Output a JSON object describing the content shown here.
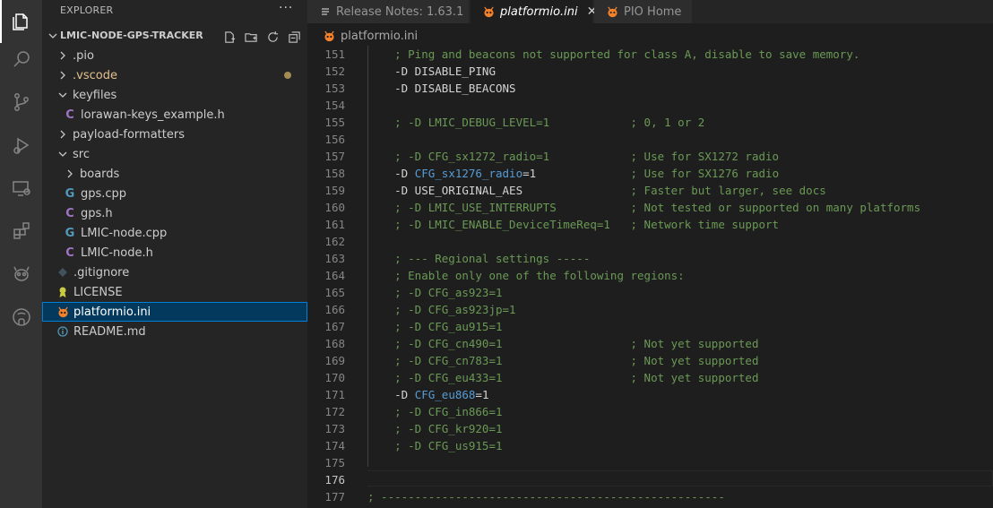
{
  "explorer": {
    "title": "EXPLORER",
    "more": "···",
    "section_title": "LMIC-NODE-GPS-TRACKER",
    "items": [
      {
        "label": ".pio",
        "type": "folder",
        "open": false,
        "depth": 1,
        "icon": "chevron-right-icon"
      },
      {
        "label": ".vscode",
        "type": "folder",
        "open": false,
        "depth": 1,
        "modified": true,
        "icon": "chevron-right-icon"
      },
      {
        "label": "keyfiles",
        "type": "folder",
        "open": true,
        "depth": 1,
        "icon": "chevron-down-icon"
      },
      {
        "label": "lorawan-keys_example.h",
        "type": "c-header",
        "depth": 2,
        "glyph": "C"
      },
      {
        "label": "payload-formatters",
        "type": "folder",
        "open": false,
        "depth": 1,
        "icon": "chevron-right-icon"
      },
      {
        "label": "src",
        "type": "folder",
        "open": true,
        "depth": 1,
        "icon": "chevron-down-icon"
      },
      {
        "label": "boards",
        "type": "folder",
        "open": false,
        "depth": 2,
        "icon": "chevron-right-icon"
      },
      {
        "label": "gps.cpp",
        "type": "cpp",
        "depth": 2,
        "glyph": "G"
      },
      {
        "label": "gps.h",
        "type": "c-header",
        "depth": 2,
        "glyph": "C"
      },
      {
        "label": "LMIC-node.cpp",
        "type": "cpp",
        "depth": 2,
        "glyph": "G"
      },
      {
        "label": "LMIC-node.h",
        "type": "c-header",
        "depth": 2,
        "glyph": "C"
      },
      {
        "label": ".gitignore",
        "type": "gitignore",
        "depth": 1
      },
      {
        "label": "LICENSE",
        "type": "license",
        "depth": 1
      },
      {
        "label": "platformio.ini",
        "type": "platformio",
        "depth": 1,
        "selected": true
      },
      {
        "label": "README.md",
        "type": "info",
        "depth": 1
      }
    ]
  },
  "tabs": [
    {
      "label": "Release Notes: 1.63.1",
      "active": false
    },
    {
      "label": "platformio.ini",
      "active": true,
      "close": "✕"
    },
    {
      "label": "PIO Home",
      "active": false
    }
  ],
  "breadcrumb": {
    "file": "platformio.ini"
  },
  "editor": {
    "lines": [
      {
        "n": "151",
        "parts": [
          {
            "t": "    ; Ping and beacons not supported for class A, disable to save memory.",
            "c": "cm"
          }
        ]
      },
      {
        "n": "152",
        "parts": [
          {
            "t": "    -D DISABLE_PING",
            "c": ""
          }
        ]
      },
      {
        "n": "153",
        "parts": [
          {
            "t": "    -D DISABLE_BEACONS",
            "c": ""
          }
        ]
      },
      {
        "n": "154",
        "parts": []
      },
      {
        "n": "155",
        "parts": [
          {
            "t": "    ; -D LMIC_DEBUG_LEVEL=1            ; 0, 1 or 2",
            "c": "cm"
          }
        ]
      },
      {
        "n": "156",
        "parts": []
      },
      {
        "n": "157",
        "parts": [
          {
            "t": "    ; -D CFG_sx1272_radio=1            ; Use for SX1272 radio",
            "c": "cm"
          }
        ]
      },
      {
        "n": "158",
        "parts": [
          {
            "t": "    -D ",
            "c": ""
          },
          {
            "t": "CFG_sx1276_radio",
            "c": "kw"
          },
          {
            "t": "=1              ",
            "c": ""
          },
          {
            "t": "; Use for SX1276 radio",
            "c": "cm"
          }
        ]
      },
      {
        "n": "159",
        "parts": [
          {
            "t": "    -D USE_ORIGINAL_AES                ",
            "c": ""
          },
          {
            "t": "; Faster but larger, see docs",
            "c": "cm"
          }
        ]
      },
      {
        "n": "160",
        "parts": [
          {
            "t": "    ; -D LMIC_USE_INTERRUPTS           ; Not tested or supported on many platforms",
            "c": "cm"
          }
        ]
      },
      {
        "n": "161",
        "parts": [
          {
            "t": "    ; -D LMIC_ENABLE_DeviceTimeReq=1   ; Network time support",
            "c": "cm"
          }
        ]
      },
      {
        "n": "162",
        "parts": []
      },
      {
        "n": "163",
        "parts": [
          {
            "t": "    ; --- Regional settings -----",
            "c": "cm"
          }
        ]
      },
      {
        "n": "164",
        "parts": [
          {
            "t": "    ; Enable only one of the following regions:",
            "c": "cm"
          }
        ]
      },
      {
        "n": "165",
        "parts": [
          {
            "t": "    ; -D CFG_as923=1",
            "c": "cm"
          }
        ]
      },
      {
        "n": "166",
        "parts": [
          {
            "t": "    ; -D CFG_as923jp=1",
            "c": "cm"
          }
        ]
      },
      {
        "n": "167",
        "parts": [
          {
            "t": "    ; -D CFG_au915=1",
            "c": "cm"
          }
        ]
      },
      {
        "n": "168",
        "parts": [
          {
            "t": "    ; -D CFG_cn490=1                   ; Not yet supported",
            "c": "cm"
          }
        ]
      },
      {
        "n": "169",
        "parts": [
          {
            "t": "    ; -D CFG_cn783=1                   ; Not yet supported",
            "c": "cm"
          }
        ]
      },
      {
        "n": "170",
        "parts": [
          {
            "t": "    ; -D CFG_eu433=1                   ; Not yet supported",
            "c": "cm"
          }
        ]
      },
      {
        "n": "171",
        "parts": [
          {
            "t": "    -D ",
            "c": ""
          },
          {
            "t": "CFG_eu868",
            "c": "kw"
          },
          {
            "t": "=1",
            "c": ""
          }
        ]
      },
      {
        "n": "172",
        "parts": [
          {
            "t": "    ; -D CFG_in866=1",
            "c": "cm"
          }
        ]
      },
      {
        "n": "173",
        "parts": [
          {
            "t": "    ; -D CFG_kr920=1",
            "c": "cm"
          }
        ]
      },
      {
        "n": "174",
        "parts": [
          {
            "t": "    ; -D CFG_us915=1",
            "c": "cm"
          }
        ]
      },
      {
        "n": "175",
        "parts": []
      },
      {
        "n": "176",
        "parts": [],
        "current": true
      },
      {
        "n": "177",
        "parts": [
          {
            "t": "; ---------------------------------------------------",
            "c": "cm"
          }
        ]
      }
    ]
  }
}
